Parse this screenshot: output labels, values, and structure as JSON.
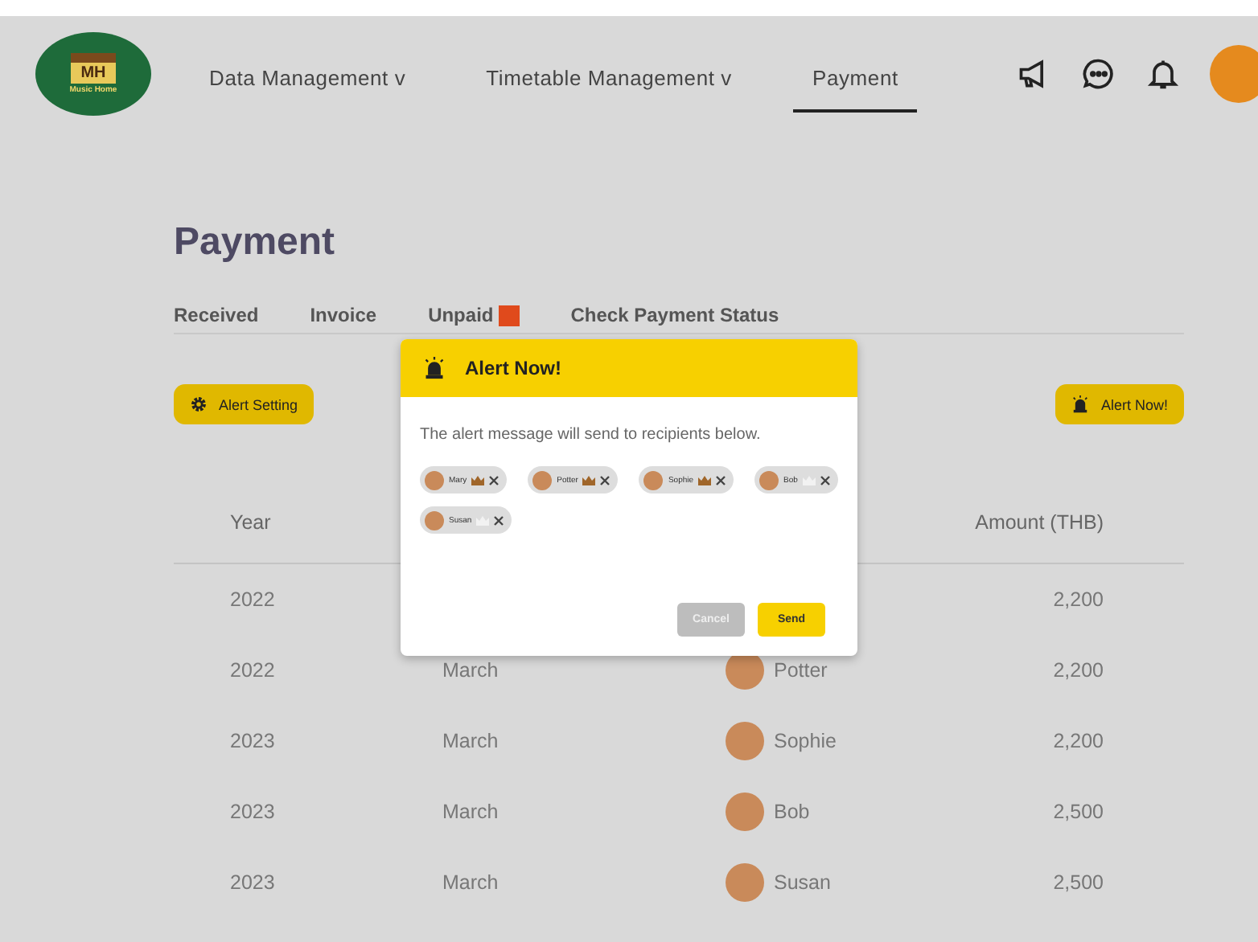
{
  "logo": {
    "initials": "MH",
    "caption": "Music Home"
  },
  "nav": [
    {
      "label": "Data Management v",
      "selected": false
    },
    {
      "label": "Timetable Management v",
      "selected": false
    },
    {
      "label": "Payment",
      "selected": true
    }
  ],
  "page_title": "Payment",
  "tabs": [
    {
      "label": "Received",
      "selected": false,
      "badge": false
    },
    {
      "label": "Invoice",
      "selected": false,
      "badge": false
    },
    {
      "label": "Unpaid",
      "selected": false,
      "badge": true
    },
    {
      "label": "Check Payment Status",
      "selected": false,
      "badge": false
    }
  ],
  "alert_setting_button": "Alert Setting",
  "alert_now_button": "Alert Now!",
  "table": {
    "columns": [
      {
        "label": "Year"
      },
      {
        "label": "Amount (THB)"
      }
    ],
    "rows": [
      {
        "year": "2022",
        "amount": "2,200"
      },
      {
        "year": "2022",
        "month": "March",
        "student": "Potter",
        "amount": "2,200"
      },
      {
        "year": "2023",
        "month": "March",
        "student": "Sophie",
        "amount": "2,200"
      },
      {
        "year": "2023",
        "month": "March",
        "student": "Bob",
        "amount": "2,500"
      },
      {
        "year": "2023",
        "month": "March",
        "student": "Susan",
        "amount": "2,500"
      }
    ]
  },
  "dialog": {
    "title": "Alert Now!",
    "message": "The alert message will send to recipients below.",
    "recipients": [
      {
        "name": "Mary",
        "crowned": true
      },
      {
        "name": "Potter",
        "crowned": true
      },
      {
        "name": "Sophie",
        "crowned": true
      },
      {
        "name": "Bob",
        "crowned": false
      },
      {
        "name": "Susan",
        "crowned": false
      }
    ],
    "buttons": [
      {
        "label": "Cancel",
        "kind": "secondary"
      },
      {
        "label": "Send",
        "kind": "primary"
      }
    ]
  }
}
